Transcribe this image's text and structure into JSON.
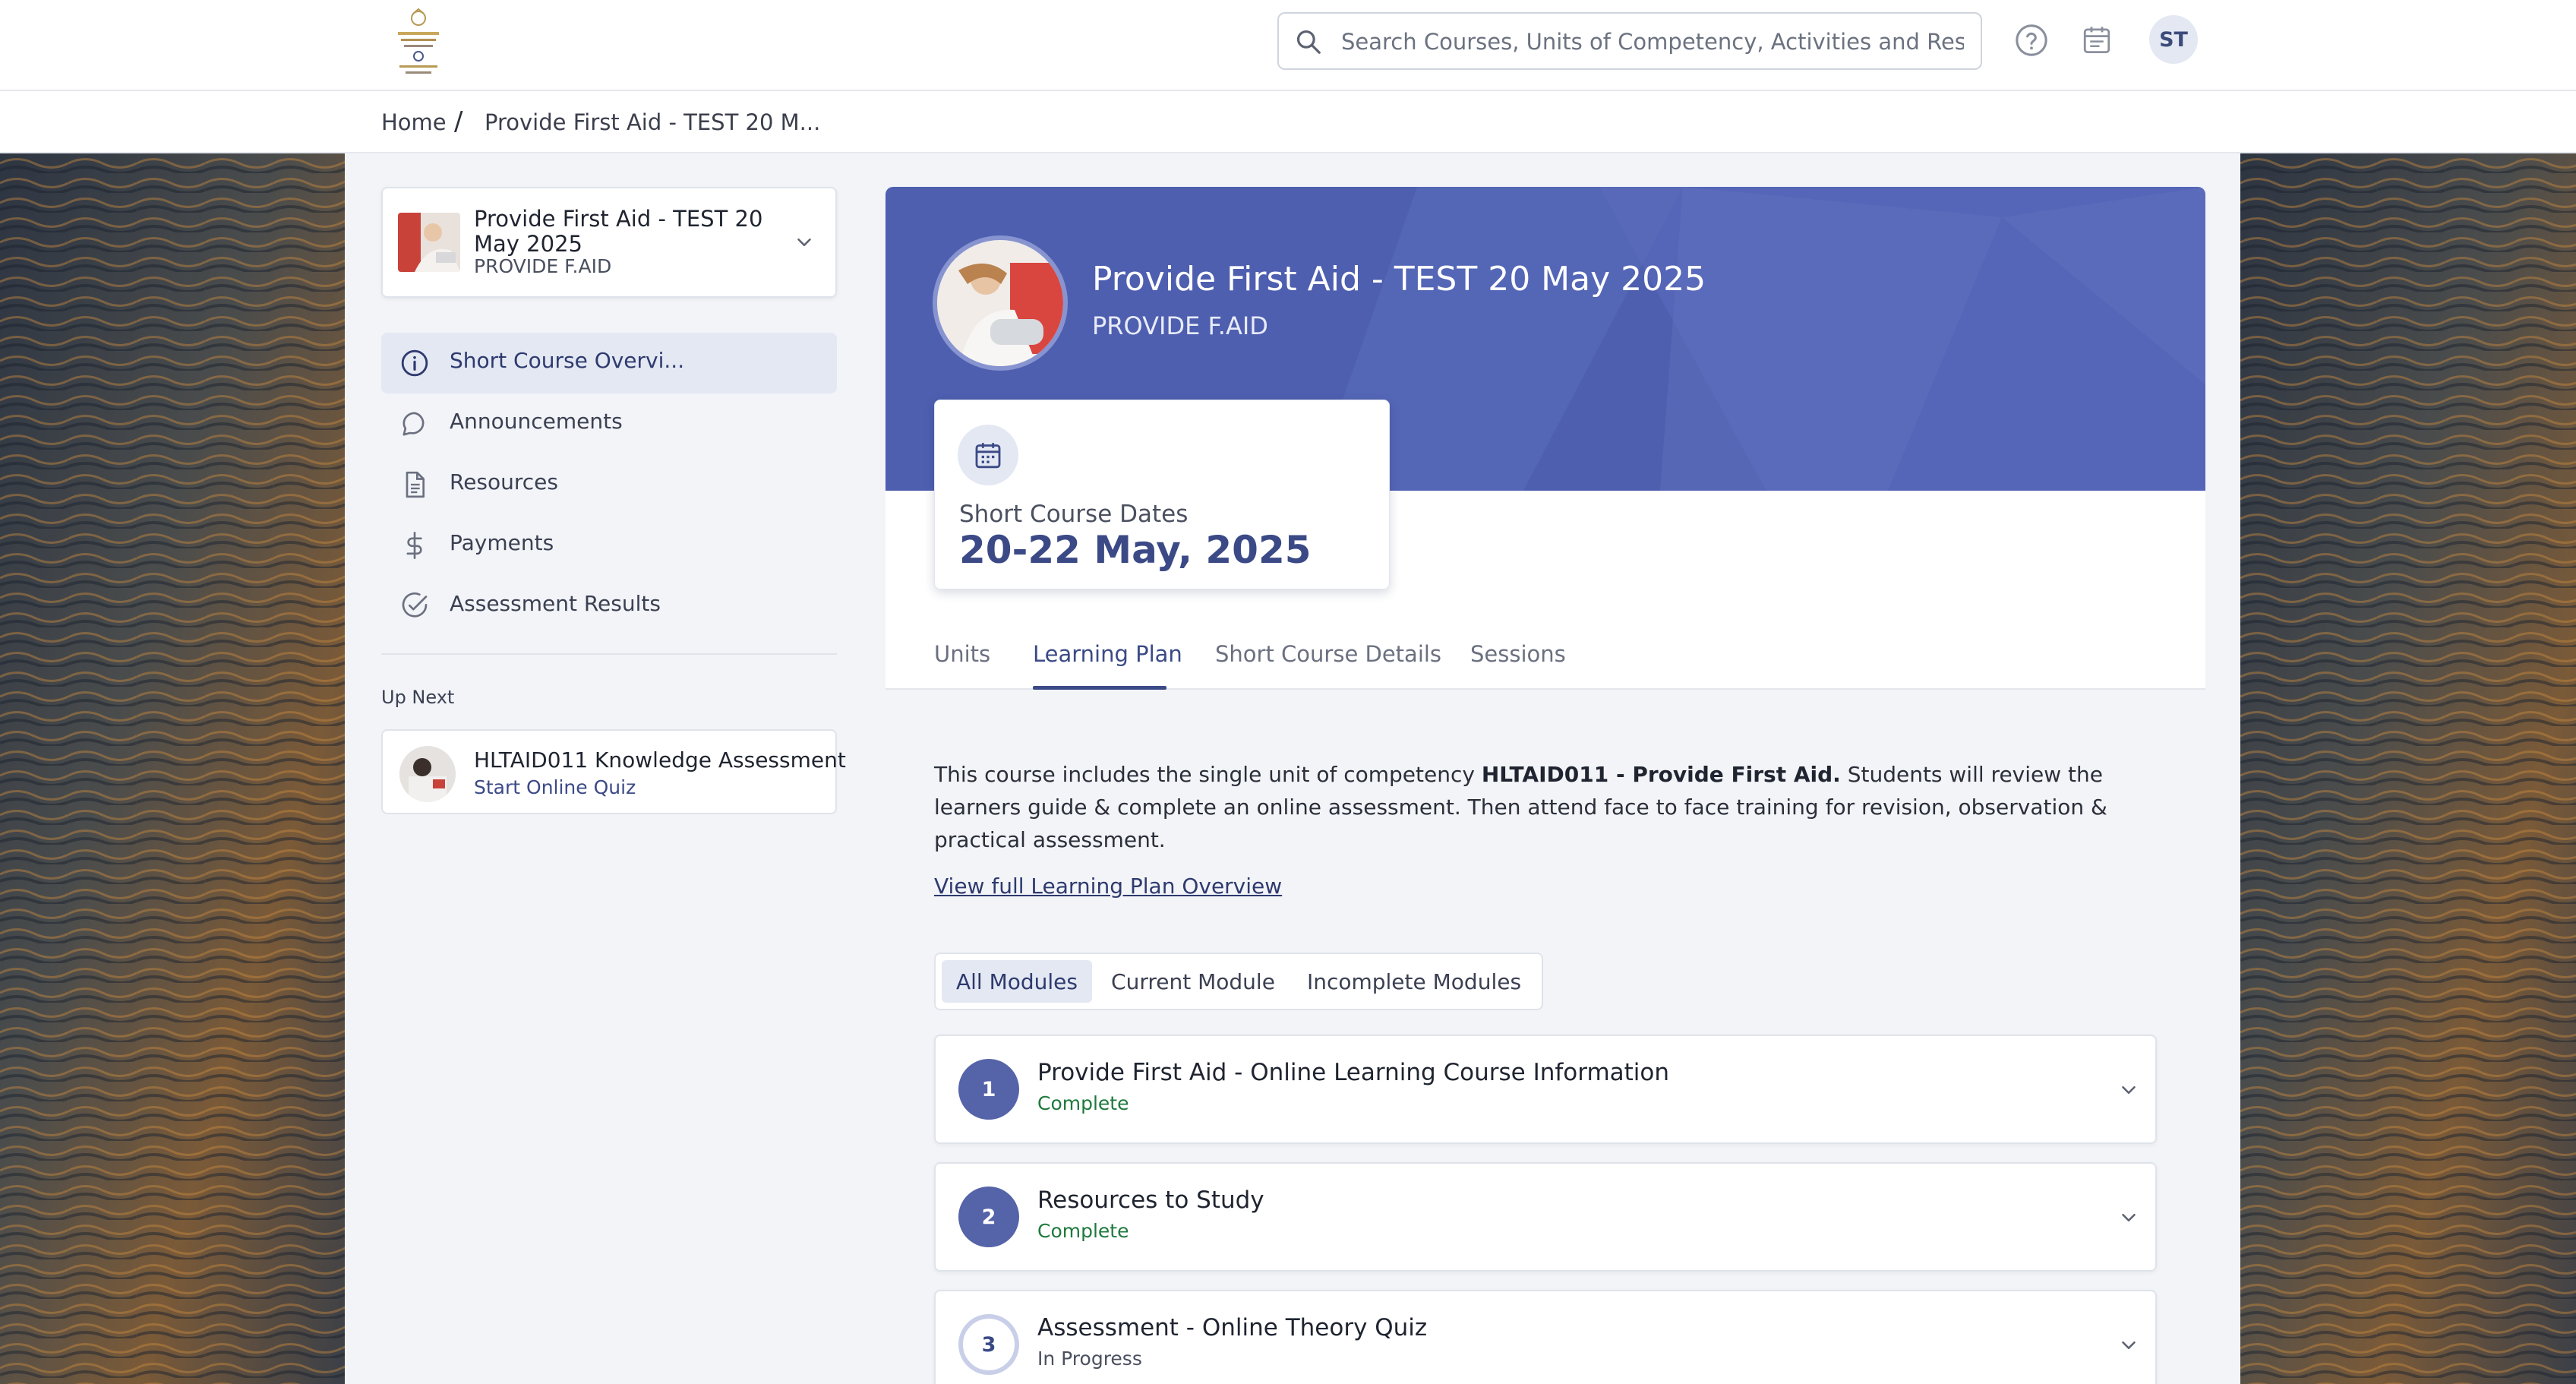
{
  "header": {
    "search_placeholder": "Search Courses, Units of Competency, Activities and Res...",
    "user_initials": "ST",
    "icons": [
      "search-icon",
      "help-icon",
      "calendar-icon"
    ]
  },
  "breadcrumb": {
    "home": "Home",
    "separator": "/",
    "current": "Provide First Aid - TEST 20 M..."
  },
  "sidebar": {
    "course": {
      "title": "Provide First Aid - TEST 20 May 2025",
      "code": "PROVIDE F.AID"
    },
    "items": [
      {
        "label": "Short Course Overvi...",
        "icon": "info-icon",
        "active": true
      },
      {
        "label": "Announcements",
        "icon": "chat-bubble-icon",
        "active": false
      },
      {
        "label": "Resources",
        "icon": "document-icon",
        "active": false
      },
      {
        "label": "Payments",
        "icon": "dollar-icon",
        "active": false
      },
      {
        "label": "Assessment Results",
        "icon": "check-circle-icon",
        "active": false
      }
    ],
    "up_next": {
      "label": "Up Next",
      "title": "HLTAID011 Knowledge Assessment",
      "action": "Start Online Quiz"
    }
  },
  "main": {
    "title": "Provide First Aid - TEST 20 May 2025",
    "subtitle": "PROVIDE F.AID",
    "dates": {
      "label": "Short Course Dates",
      "value": "20-22 May, 2025"
    },
    "tabs": [
      {
        "label": "Units",
        "active": false
      },
      {
        "label": "Learning Plan",
        "active": true
      },
      {
        "label": "Short Course Details",
        "active": false
      },
      {
        "label": "Sessions",
        "active": false
      }
    ],
    "description": {
      "before": "This course includes the single unit of competency ",
      "bold": "HLTAID011 - Provide First Aid.",
      "after": " Students will review the learners guide & complete an online assessment. Then attend face to face training for revision, observation & practical assessment."
    },
    "plan_link": "View full Learning Plan Overview",
    "filters": [
      {
        "label": "All Modules",
        "active": true
      },
      {
        "label": "Current Module",
        "active": false
      },
      {
        "label": "Incomplete Modules",
        "active": false
      }
    ],
    "modules": [
      {
        "number": "1",
        "title": "Provide First Aid - Online Learning Course Information",
        "status": "Complete",
        "status_color": "#1e7a3c"
      },
      {
        "number": "2",
        "title": "Resources to Study",
        "status": "Complete",
        "status_color": "#1e7a3c"
      },
      {
        "number": "3",
        "title": "Assessment - Online Theory Quiz",
        "status": "In Progress",
        "status_color": "#4b5060"
      }
    ]
  },
  "colors": {
    "accent": "#3b4a86",
    "hero": "#4e5fb0",
    "nav_active_bg": "#e3e8f3",
    "complete": "#1e7a3c"
  }
}
